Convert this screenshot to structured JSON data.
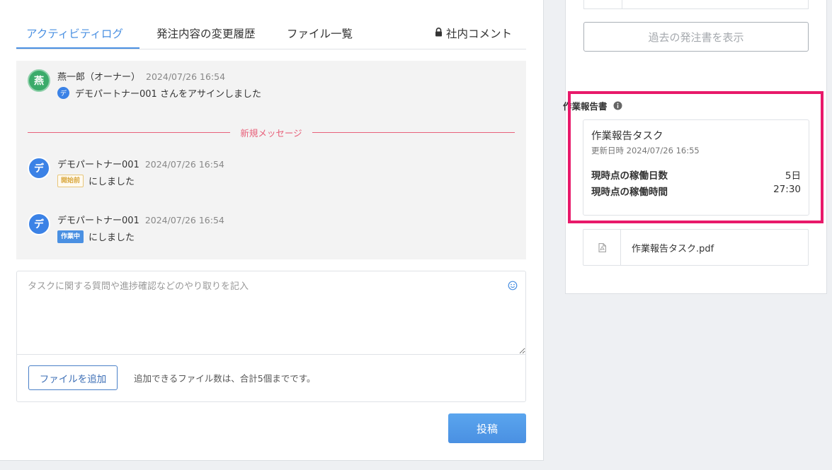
{
  "tabs": [
    {
      "label": "アクティビティログ",
      "active": true
    },
    {
      "label": "発注内容の変更履歴",
      "active": false
    },
    {
      "label": "ファイル一覧",
      "active": false
    },
    {
      "label": "社内コメント",
      "active": false,
      "icon": "lock-icon"
    }
  ],
  "activity": {
    "entries": [
      {
        "avatar_char": "燕",
        "avatar_color": "#3bab6a",
        "name": "燕一郎（オーナー）",
        "time": "2024/07/26 16:54",
        "mini_avatar_char": "デ",
        "text": "デモパートナー001 さんをアサインしました"
      },
      {
        "avatar_char": "デ",
        "avatar_color": "#3b82e6",
        "name": "デモパートナー001",
        "time": "2024/07/26 16:54",
        "badge": "開始前",
        "text": "にしました"
      },
      {
        "avatar_char": "デ",
        "avatar_color": "#3b82e6",
        "name": "デモパートナー001",
        "time": "2024/07/26 16:54",
        "badge": "作業中",
        "text": "にしました"
      }
    ],
    "new_message_divider": "新規メッセージ"
  },
  "compose": {
    "placeholder": "タスクに関する質問や進捗確認などのやり取りを記入",
    "add_file_label": "ファイルを追加",
    "file_note": "追加できるファイル数は、合計5個までです。",
    "post_label": "投稿"
  },
  "sidebar": {
    "past_orders_label": "過去の発注書を表示",
    "report_heading": "作業報告書",
    "report": {
      "title": "作業報告タスク",
      "updated_label": "更新日時",
      "updated_value": "2024/07/26 16:55",
      "days_label": "現時点の稼働日数",
      "days_value": "5日",
      "hours_label": "現時点の稼働時間",
      "hours_value": "27:30"
    },
    "file_name": "作業報告タスク.pdf"
  },
  "colors": {
    "accent": "#4a90e2",
    "highlight": "#e8196a",
    "divider": "#e8607a"
  }
}
